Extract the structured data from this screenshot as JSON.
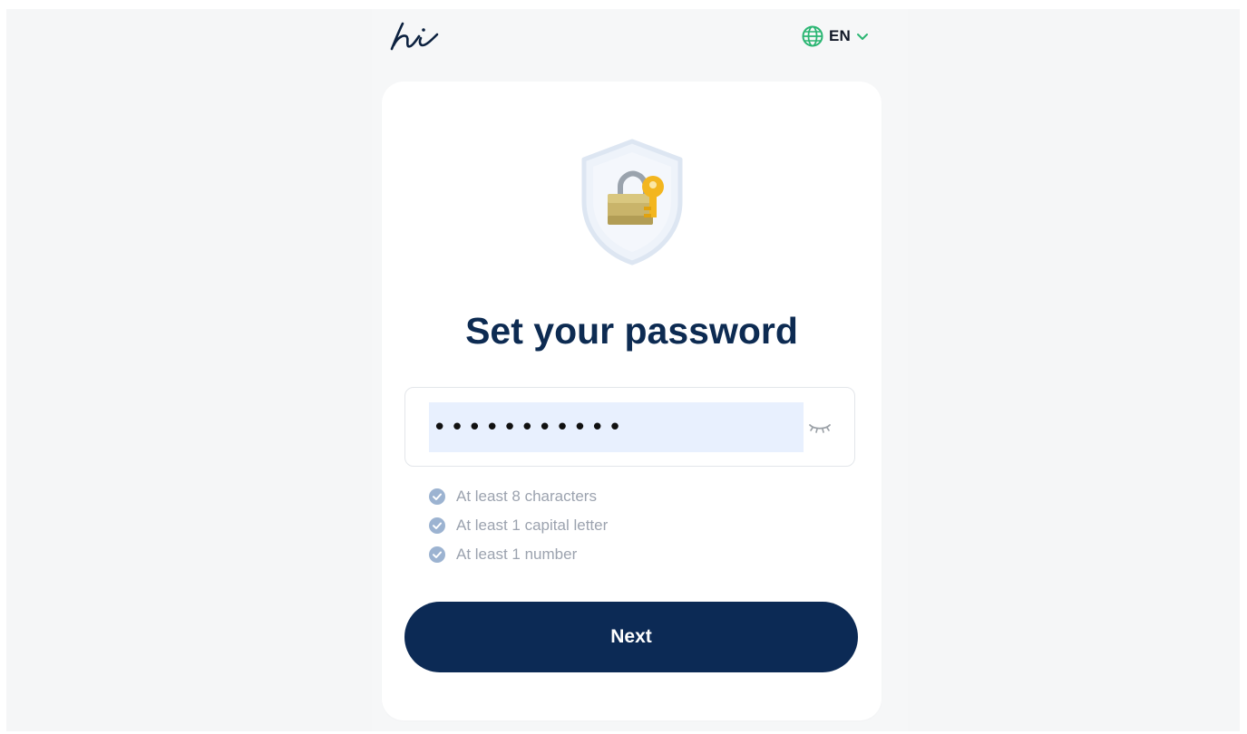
{
  "header": {
    "logo_text": "hi",
    "language": {
      "current": "EN",
      "icon": "globe-icon",
      "chevron_icon": "chevron-down-icon",
      "accent_color": "#2bb673"
    }
  },
  "card": {
    "hero_icon": "shield-lock-key-icon",
    "title": "Set your password",
    "password": {
      "value": "•••••••••••",
      "visibility_icon": "eye-closed-icon"
    },
    "requirements": [
      {
        "label": "At least 8 characters",
        "icon": "check-circle-icon"
      },
      {
        "label": "At least 1 capital letter",
        "icon": "check-circle-icon"
      },
      {
        "label": "At least 1 number",
        "icon": "check-circle-icon"
      }
    ],
    "next_label": "Next"
  },
  "colors": {
    "primary": "#0c2a55",
    "title": "#0d2b52",
    "requirement_check": "#9cb3d1",
    "input_autofill_bg": "#e8f0fe"
  }
}
